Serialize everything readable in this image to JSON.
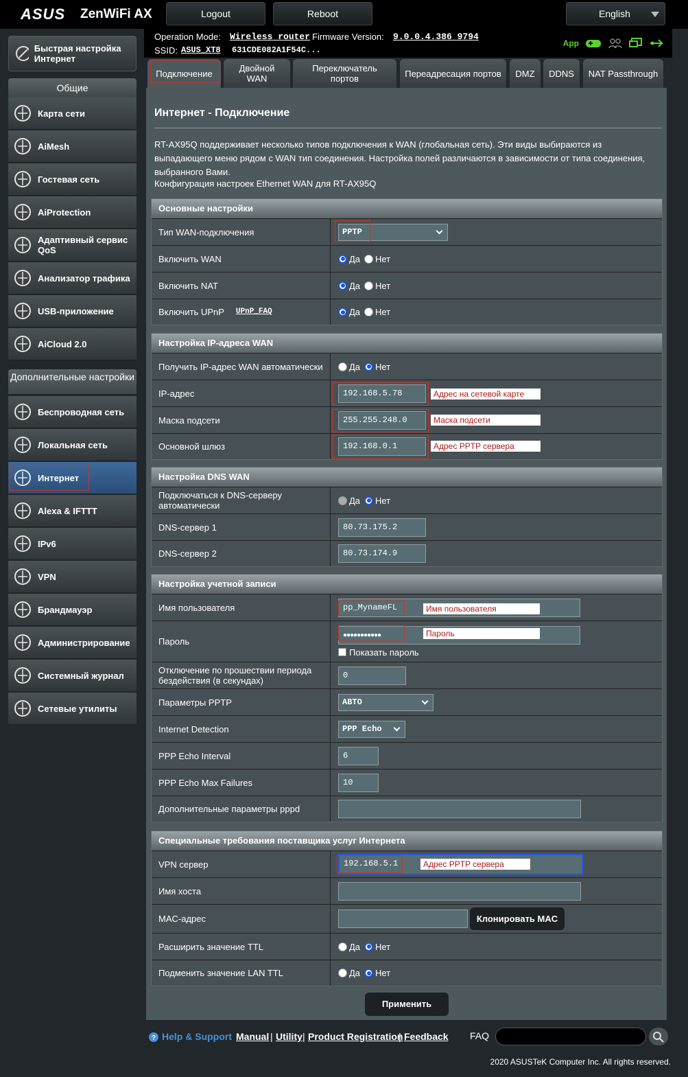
{
  "header": {
    "brand": "ASUS",
    "product": "ZenWiFi AX",
    "logout_label": "Logout",
    "reboot_label": "Reboot",
    "language": "English"
  },
  "status": {
    "op_mode_label": "Operation Mode:",
    "op_mode_value": "Wireless router",
    "fw_label": "Firmware Version:",
    "fw_value": "9.0.0.4.386_9794",
    "ssid_label": "SSID:",
    "ssid_value": "ASUS_XT8",
    "ssid_value2": "631CDE082A1F54C...",
    "app_label": "App"
  },
  "sidebar": {
    "quick_setup": "Быстрая настройка Интернет",
    "general_header": "Общие",
    "general_items": [
      {
        "label": "Карта сети",
        "icon": "network-map-icon"
      },
      {
        "label": "AiMesh",
        "icon": "aimesh-icon"
      },
      {
        "label": "Гостевая сеть",
        "icon": "guest-network-icon"
      },
      {
        "label": "AiProtection",
        "icon": "shield-icon"
      },
      {
        "label": "Адаптивный сервис QoS",
        "icon": "qos-gauge-icon"
      },
      {
        "label": "Анализатор трафика",
        "icon": "traffic-analyzer-icon"
      },
      {
        "label": "USB-приложение",
        "icon": "usb-icon"
      },
      {
        "label": "AiCloud 2.0",
        "icon": "cloud-icon"
      }
    ],
    "advanced_header": "Дополнительные настройки",
    "advanced_items": [
      {
        "label": "Беспроводная сеть",
        "icon": "wireless-icon"
      },
      {
        "label": "Локальная сеть",
        "icon": "lan-icon"
      },
      {
        "label": "Интернет",
        "icon": "globe-icon"
      },
      {
        "label": "Alexa & IFTTT",
        "icon": "alexa-icon"
      },
      {
        "label": "IPv6",
        "icon": "ipv6-icon"
      },
      {
        "label": "VPN",
        "icon": "vpn-icon"
      },
      {
        "label": "Брандмауэр",
        "icon": "firewall-icon"
      },
      {
        "label": "Администрирование",
        "icon": "gear-icon"
      },
      {
        "label": "Системный журнал",
        "icon": "log-icon"
      },
      {
        "label": "Сетевые утилиты",
        "icon": "tools-icon"
      }
    ]
  },
  "tabs": [
    "Подключение",
    "Двойной WAN",
    "Переключатель портов",
    "Переадресация портов",
    "DMZ",
    "DDNS",
    "NAT Passthrough"
  ],
  "page": {
    "title": "Интернет - Подключение",
    "description": "RT-AX95Q поддерживает несколько типов подключения к WAN (глобальная сеть). Эти виды выбираются из выпадающего меню рядом с WAN тип соединения. Настройка полей различаются в зависимости от типа соединения, выбранного Вами.",
    "config_line": "Конфигурация настроек Ethernet WAN для RT-AX95Q"
  },
  "basic": {
    "header": "Основные настройки",
    "wan_type_label": "Тип WAN-подключения",
    "wan_type_value": "PPTP",
    "enable_wan_label": "Включить WAN",
    "enable_nat_label": "Включить NAT",
    "enable_upnp_label": "Включить UPnP",
    "upnp_faq": "UPnP_FAQ"
  },
  "yes": "Да",
  "no": "Нет",
  "ip": {
    "header": "Настройка IP-адреса WAN",
    "auto_label": "Получить IP-адрес WAN автоматически",
    "ip_label": "IP-адрес",
    "ip_value": "192.168.5.78",
    "ip_note": "Адрес на сетевой карте",
    "mask_label": "Маска подсети",
    "mask_value": "255.255.248.0",
    "mask_note": "Маска подсети",
    "gw_label": "Основной шлюз",
    "gw_value": "192.168.0.1",
    "gw_note": "Адрес PPTP сервера"
  },
  "dns": {
    "header": "Настройка DNS WAN",
    "auto_label": "Подключаться к DNS-серверу автоматически",
    "dns1_label": "DNS-сервер 1",
    "dns1_value": "80.73.175.2",
    "dns2_label": "DNS-сервер 2",
    "dns2_value": "80.73.174.9"
  },
  "account": {
    "header": "Настройка учетной записи",
    "user_label": "Имя пользователя",
    "user_value": "pp_MynameFL",
    "user_note": "Имя пользователя",
    "pass_label": "Пароль",
    "pass_value": "●●●●●●●●●●●",
    "pass_note": "Пароль",
    "show_pass": "Показать пароль",
    "idle_label": "Отключение по прошествии периода бездействия (в секундах)",
    "idle_value": "0",
    "pptp_label": "Параметры PPTP",
    "pptp_value": "АВТО",
    "detect_label": "Internet Detection",
    "detect_value": "PPP Echo",
    "echo_int_label": "PPP Echo Interval",
    "echo_int_value": "6",
    "echo_fail_label": "PPP Echo Max Failures",
    "echo_fail_value": "10",
    "pppd_label": "Дополнительные параметры pppd"
  },
  "isp": {
    "header": "Специальные требования поставщика услуг Интернета",
    "vpn_label": "VPN сервер",
    "vpn_value": "192.168.5.1",
    "vpn_note": "Адрес PPTP сервера",
    "host_label": "Имя хоста",
    "mac_label": "MAC-адрес",
    "clone_mac": "Клонировать MAC",
    "ttl_label": "Расширить значение TTL",
    "lanttl_label": "Подменить значение LAN TTL"
  },
  "apply_label": "Применить",
  "footer": {
    "help": "Help & Support",
    "manual": "Manual",
    "utility": "Utility",
    "registration": "Product Registration",
    "feedback": "Feedback",
    "faq": "FAQ",
    "copyright": "2020 ASUSTeK Computer Inc. All rights reserved."
  }
}
